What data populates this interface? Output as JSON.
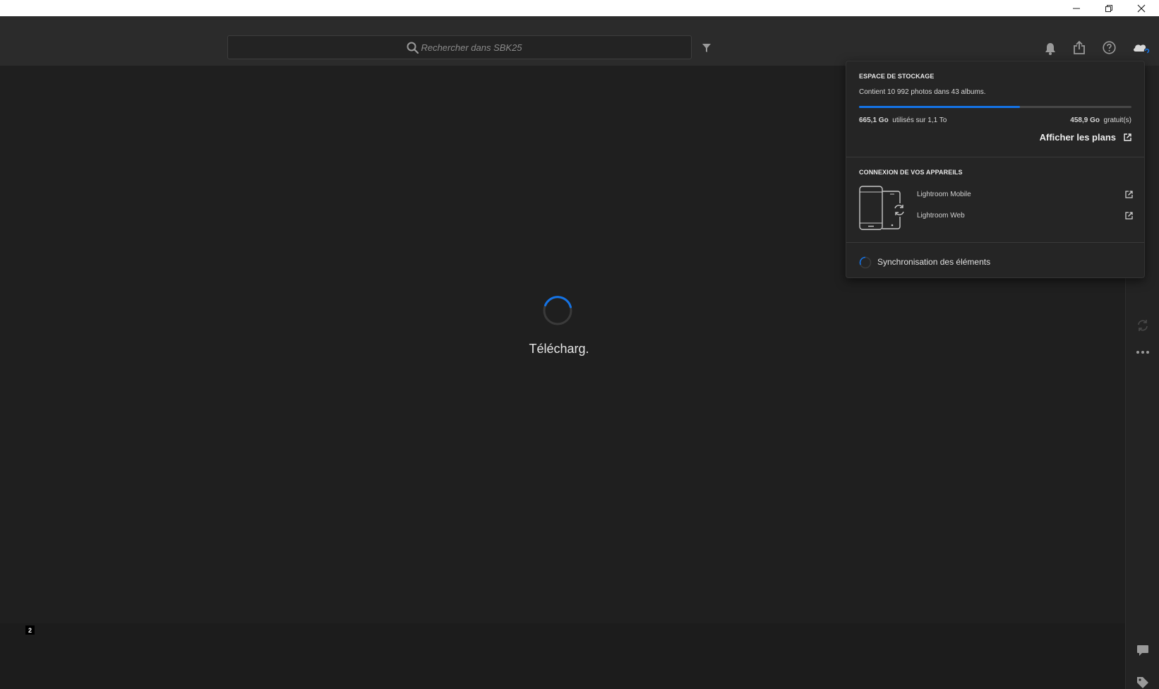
{
  "window": {
    "minimize_icon": "minimize-icon",
    "maximize_icon": "restore-icon",
    "close_icon": "close-icon"
  },
  "topbar": {
    "search_placeholder": "Rechercher dans SBK25",
    "icons": [
      "search-icon",
      "filter-icon",
      "bell-icon",
      "share-icon",
      "help-icon",
      "cloud-sync-icon"
    ]
  },
  "main": {
    "loading_label": "Télécharg.",
    "badge_count": "2"
  },
  "storage": {
    "title": "ESPACE DE STOCKAGE",
    "summary": "Contient 10 992 photos dans 43 albums.",
    "used_value": "665,1 Go",
    "used_suffix": "utilisés sur 1,1 To",
    "free_value": "458,9 Go",
    "free_suffix": "gratuit(s)",
    "used_fraction": 0.59,
    "plans_link": "Afficher les plans"
  },
  "devices": {
    "title": "CONNEXION DE VOS APPAREILS",
    "links": [
      "Lightroom Mobile",
      "Lightroom Web"
    ]
  },
  "sync": {
    "label": "Synchronisation des éléments"
  },
  "colors": {
    "accent": "#1473e6",
    "background": "#1e1e1e",
    "panel": "#252525"
  }
}
